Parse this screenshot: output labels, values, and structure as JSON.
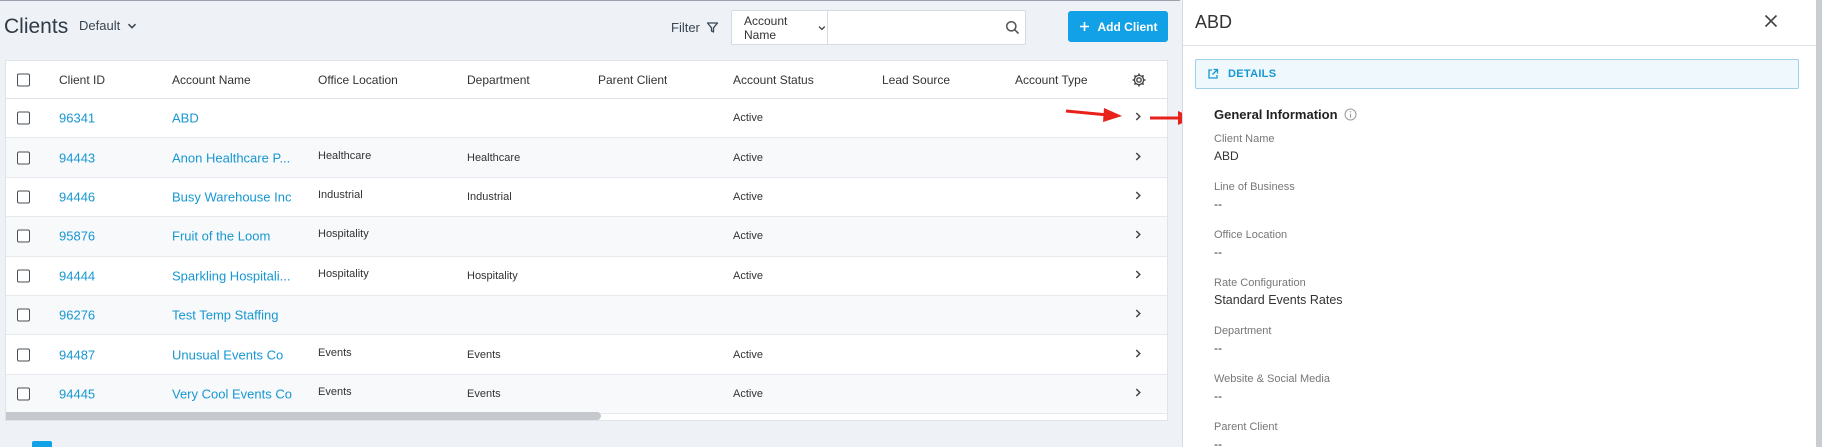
{
  "header": {
    "title": "Clients",
    "view": "Default",
    "filter_label": "Filter",
    "search_field": "Account Name",
    "search_value": "",
    "add_label": "Add Client"
  },
  "table": {
    "columns": [
      "Client ID",
      "Account Name",
      "Office Location",
      "Department",
      "Parent Client",
      "Account Status",
      "Lead Source",
      "Account Type"
    ],
    "rows": [
      {
        "id": "96341",
        "name": "ABD",
        "office": "",
        "dept": "",
        "parent": "",
        "status": "Active",
        "lead": "",
        "type": ""
      },
      {
        "id": "94443",
        "name": "Anon Healthcare P...",
        "office": "Healthcare",
        "dept": "Healthcare",
        "parent": "",
        "status": "Active",
        "lead": "",
        "type": ""
      },
      {
        "id": "94446",
        "name": "Busy Warehouse Inc",
        "office": "Industrial",
        "dept": "Industrial",
        "parent": "",
        "status": "Active",
        "lead": "",
        "type": ""
      },
      {
        "id": "95876",
        "name": "Fruit of the Loom",
        "office": "Hospitality",
        "dept": "",
        "parent": "",
        "status": "Active",
        "lead": "",
        "type": ""
      },
      {
        "id": "94444",
        "name": "Sparkling Hospitali...",
        "office": "Hospitality",
        "dept": "Hospitality",
        "parent": "",
        "status": "Active",
        "lead": "",
        "type": ""
      },
      {
        "id": "96276",
        "name": "Test Temp Staffing",
        "office": "",
        "dept": "",
        "parent": "",
        "status": "",
        "lead": "",
        "type": ""
      },
      {
        "id": "94487",
        "name": "Unusual Events Co",
        "office": "Events",
        "dept": "Events",
        "parent": "",
        "status": "Active",
        "lead": "",
        "type": ""
      },
      {
        "id": "94445",
        "name": "Very Cool Events Co",
        "office": "Events",
        "dept": "Events",
        "parent": "",
        "status": "Active",
        "lead": "",
        "type": ""
      }
    ]
  },
  "detail": {
    "title": "ABD",
    "tab_label": "DETAILS",
    "section_title": "General Information",
    "fields": [
      {
        "label": "Client Name",
        "value": "ABD"
      },
      {
        "label": "Line of Business",
        "value": "--"
      },
      {
        "label": "Office Location",
        "value": "--"
      },
      {
        "label": "Rate Configuration",
        "value": "Standard Events Rates"
      },
      {
        "label": "Department",
        "value": "--"
      },
      {
        "label": "Website & Social Media",
        "value": "--"
      },
      {
        "label": "Parent Client",
        "value": "--"
      }
    ]
  },
  "colors": {
    "accent": "#12a0e6",
    "link": "#1797d2",
    "annotation_arrow": "#e8221b"
  }
}
